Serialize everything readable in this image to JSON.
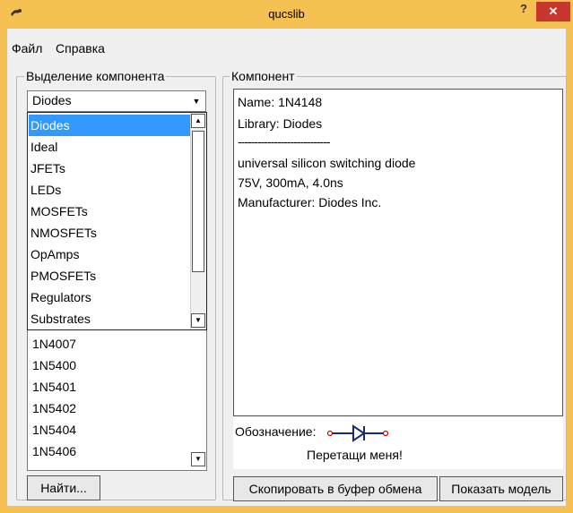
{
  "window": {
    "title": "qucslib",
    "help_label": "?",
    "close_label": "✕"
  },
  "menu": [
    "Файл",
    "Справка"
  ],
  "selection_group": {
    "title": "Выделение компонента",
    "combo_value": "Diodes",
    "dropdown_items": [
      "Diodes",
      "Ideal",
      "JFETs",
      "LEDs",
      "MOSFETs",
      "NMOSFETs",
      "OpAmps",
      "PMOSFETs",
      "Regulators",
      "Substrates"
    ],
    "selected_index": 0,
    "components": [
      "1N4007",
      "1N5400",
      "1N5401",
      "1N5402",
      "1N5404",
      "1N5406"
    ],
    "find_button": "Найти..."
  },
  "component_group": {
    "title": "Компонент",
    "info_lines": [
      "Name: 1N4148",
      "Library: Diodes",
      "----------------------------",
      "universal silicon switching diode",
      "75V, 300mA, 4.0ns",
      "Manufacturer: Diodes Inc."
    ],
    "symbol_label": "Обозначение:",
    "drag_hint": "Перетащи меня!",
    "copy_button": "Скопировать в буфер обмена",
    "model_button": "Показать модель"
  },
  "colors": {
    "title_bar": "#f4c152",
    "close": "#c7372e",
    "selection": "#3399ff",
    "diode_wire": "#1a2a7a",
    "pin": "#cc0000"
  }
}
